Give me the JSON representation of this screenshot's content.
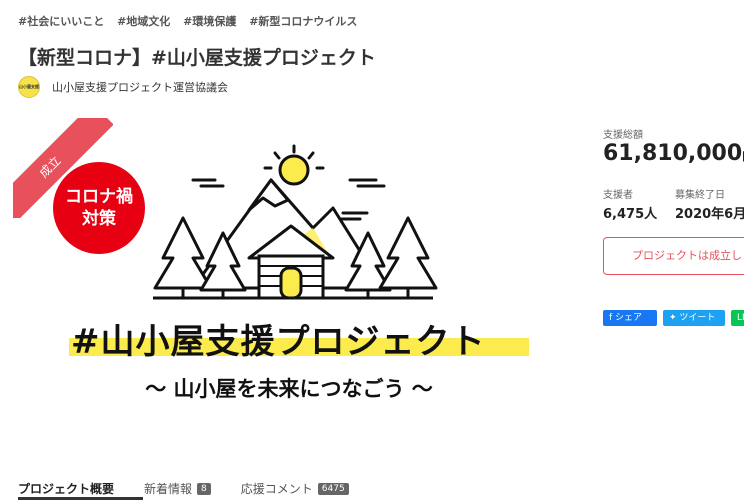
{
  "tags": [
    "#社会にいいこと",
    "#地域文化",
    "#環境保護",
    "#新型コロナウイルス"
  ],
  "title": "【新型コロナ】#山小屋支援プロジェクト",
  "owner": {
    "name": "山小屋支援プロジェクト運営協議会",
    "logo_text": "山小屋支援"
  },
  "hero": {
    "ribbon": "成立",
    "badge_line1": "コロナ禍",
    "badge_line2": "対策",
    "headline": "#山小屋支援プロジェクト",
    "subline": "～ 山小屋を未来につなごう ～"
  },
  "stats": {
    "total_label": "支援総額",
    "total_value": "61,810,000",
    "total_unit": "円",
    "supporters_label": "支援者",
    "supporters_value": "6,475人",
    "end_label": "募集終了日",
    "end_value": "2020年6月"
  },
  "status_button": "プロジェクトは成立しま",
  "share": {
    "facebook": "シェア",
    "twitter": "ツイート",
    "line": "LINE"
  },
  "tabs": [
    {
      "label": "プロジェクト概要"
    },
    {
      "label": "新着情報",
      "count": "8"
    },
    {
      "label": "応援コメント",
      "count": "6475"
    }
  ],
  "colors": {
    "accent_red": "#e8505b",
    "corona_red": "#e60012",
    "highlight_yellow": "#fbeb4d"
  }
}
